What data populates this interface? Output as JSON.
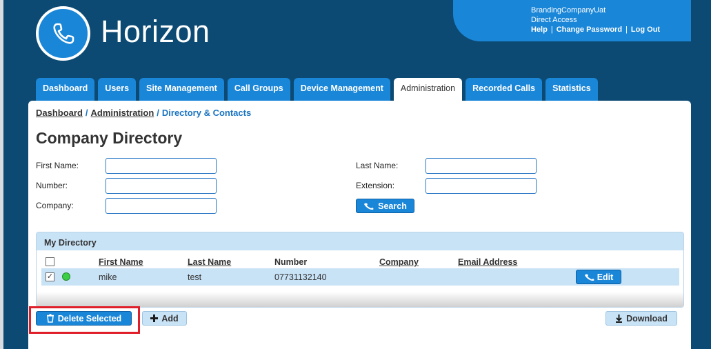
{
  "brand": {
    "name": "Horizon",
    "logo_icon": "phone-icon"
  },
  "account": {
    "company": "BrandingCompanyUat",
    "access": "Direct Access",
    "links": [
      "Help",
      "Change Password",
      "Log Out"
    ]
  },
  "tabs": [
    {
      "label": "Dashboard",
      "active": false
    },
    {
      "label": "Users",
      "active": false
    },
    {
      "label": "Site Management",
      "active": false
    },
    {
      "label": "Call Groups",
      "active": false
    },
    {
      "label": "Device Management",
      "active": false
    },
    {
      "label": "Administration",
      "active": true
    },
    {
      "label": "Recorded Calls",
      "active": false
    },
    {
      "label": "Statistics",
      "active": false
    }
  ],
  "breadcrumb": {
    "home": "Dashboard",
    "section": "Administration",
    "current": "Directory & Contacts"
  },
  "page_title": "Company Directory",
  "search_form": {
    "first_name_label": "First Name:",
    "number_label": "Number:",
    "company_label": "Company:",
    "last_name_label": "Last Name:",
    "extension_label": "Extension:",
    "first_name_value": "",
    "number_value": "",
    "company_value": "",
    "last_name_value": "",
    "extension_value": "",
    "search_button": "Search"
  },
  "directory": {
    "title": "My Directory",
    "columns": [
      "First Name",
      "Last Name",
      "Number",
      "Company",
      "Email Address"
    ],
    "rows": [
      {
        "checked": true,
        "status": "online",
        "first_name": "mike",
        "last_name": "test",
        "number": "07731132140",
        "company": "",
        "email": "",
        "edit_label": "Edit"
      }
    ]
  },
  "actions": {
    "delete_selected": "Delete Selected",
    "add": "Add",
    "download": "Download"
  },
  "colors": {
    "page_bg": "#0c4a73",
    "accent": "#1a86d8",
    "row_bg": "#c8e2f6",
    "highlight": "#e01e2a",
    "status_online": "#3ccf45"
  }
}
